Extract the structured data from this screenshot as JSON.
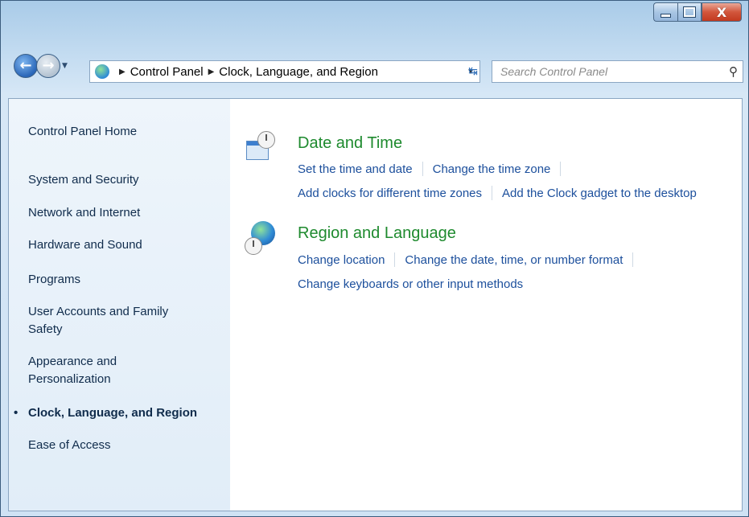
{
  "titlebar": {
    "minimize_icon": "minimize-icon",
    "maximize_icon": "maximize-icon",
    "close_label": "X"
  },
  "address": {
    "segments": [
      "Control Panel",
      "Clock, Language, and Region"
    ]
  },
  "search": {
    "placeholder": "Search Control Panel"
  },
  "sidebar": {
    "items": [
      {
        "label": "Control Panel Home"
      },
      {
        "label": "System and Security"
      },
      {
        "label": "Network and Internet"
      },
      {
        "label": "Hardware and Sound"
      },
      {
        "label": "Programs"
      },
      {
        "label": "User Accounts and Family Safety"
      },
      {
        "label": "Appearance and Personalization"
      },
      {
        "label": "Clock, Language, and Region",
        "current": true
      },
      {
        "label": "Ease of Access"
      }
    ]
  },
  "categories": [
    {
      "title": "Date and Time",
      "icon": "date-time-icon",
      "links": [
        [
          "Set the time and date",
          "Change the time zone"
        ],
        [
          "Add clocks for different time zones",
          "Add the Clock gadget to the desktop"
        ]
      ]
    },
    {
      "title": "Region and Language",
      "icon": "region-language-icon",
      "links": [
        [
          "Change location",
          "Change the date, time, or number format"
        ],
        [
          "Change keyboards or other input methods"
        ]
      ]
    }
  ],
  "colors": {
    "link": "#1c4f9c",
    "category_title": "#1e8a2e",
    "sidebar_text": "#102c4c"
  }
}
